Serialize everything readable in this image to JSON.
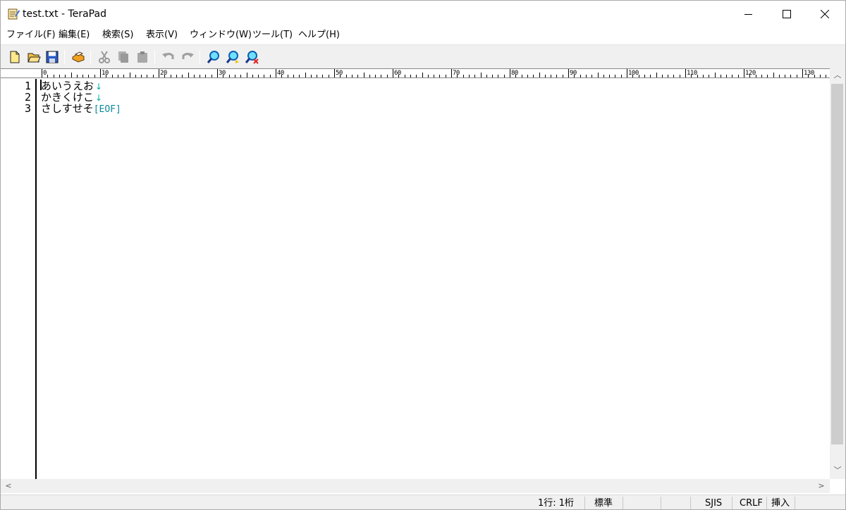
{
  "window": {
    "title": "test.txt - TeraPad"
  },
  "menu": [
    "ファイル(F)",
    "編集(E)",
    "検索(S)",
    "表示(V)",
    "ウィンドウ(W)",
    "ツール(T)",
    "ヘルプ(H)"
  ],
  "toolbar": [
    {
      "name": "new-file-icon"
    },
    {
      "name": "open-folder-icon"
    },
    {
      "name": "save-icon"
    },
    {
      "name": "print-icon"
    },
    {
      "name": "cut-icon"
    },
    {
      "name": "copy-icon"
    },
    {
      "name": "paste-icon"
    },
    {
      "name": "undo-icon"
    },
    {
      "name": "redo-icon"
    },
    {
      "name": "find-icon"
    },
    {
      "name": "find-next-icon"
    },
    {
      "name": "replace-icon"
    }
  ],
  "ruler": [
    "0",
    "10",
    "20",
    "30",
    "40",
    "50",
    "60",
    "70",
    "80",
    "90",
    "100",
    "110",
    "120",
    "130"
  ],
  "editor": {
    "line_numbers": [
      "1",
      "2",
      "3"
    ],
    "lines": [
      {
        "text": "あいうえお",
        "end": "↓"
      },
      {
        "text": "かきくけこ",
        "end": "↓"
      },
      {
        "text": "さしすせそ",
        "end": "[EOF]"
      }
    ]
  },
  "status": {
    "position": "1行:  1桁",
    "mode": "標準",
    "encoding": "SJIS",
    "line_ending": "CRLF",
    "insert_mode": "挿入"
  },
  "colors": {
    "eof": "#0a8a9a",
    "newline_mark": "#00aaaa",
    "toolbar_bg": "#f0f0f0"
  }
}
